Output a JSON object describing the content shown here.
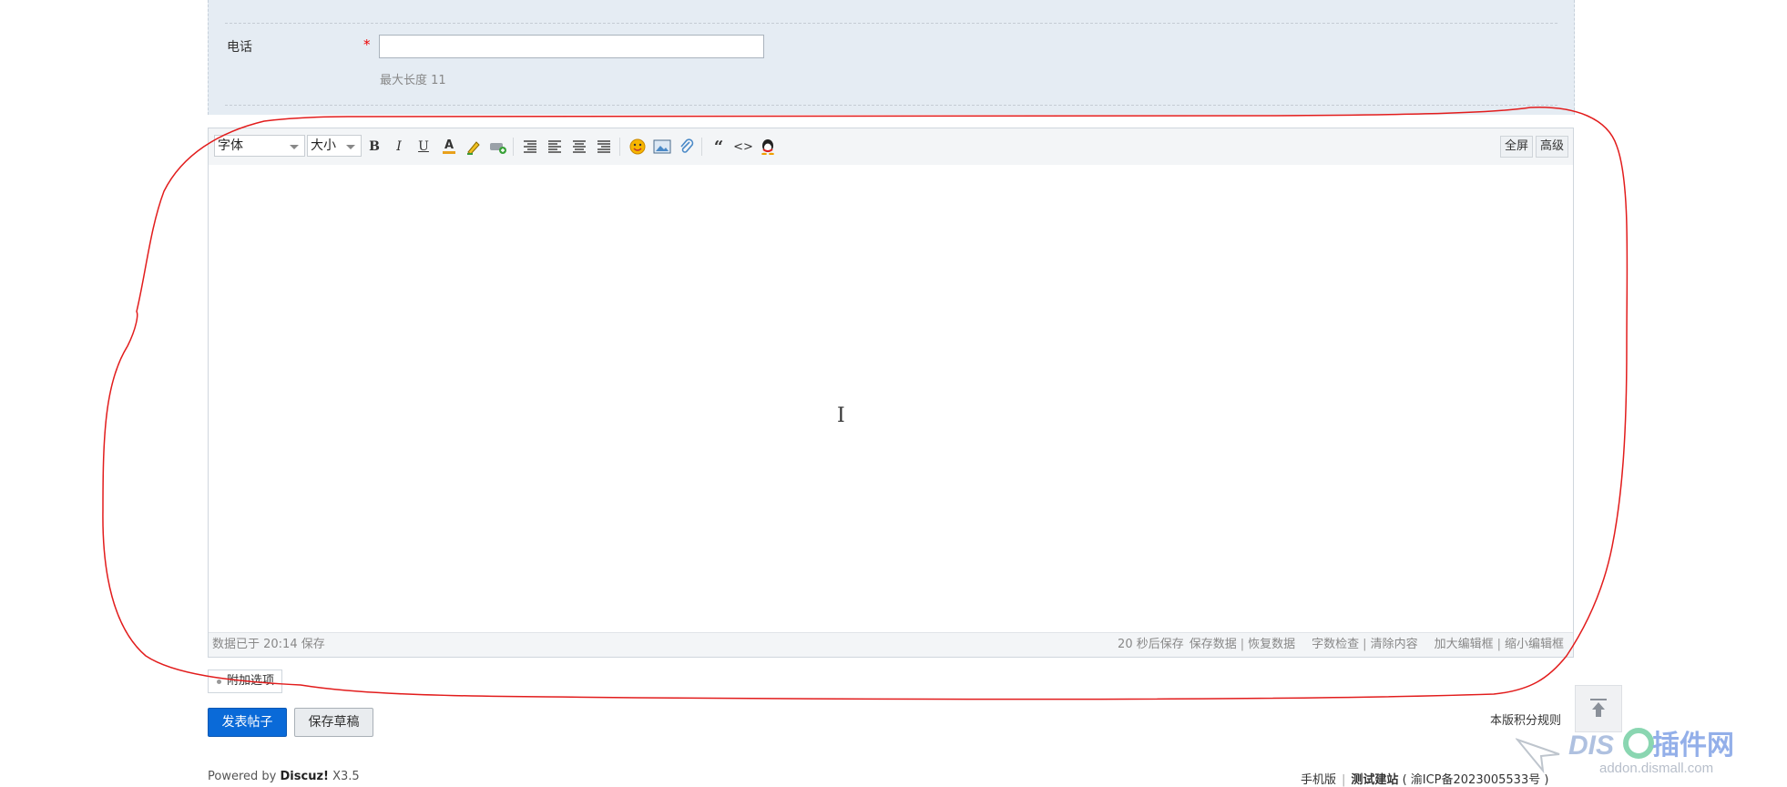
{
  "form": {
    "phone_label": "电话",
    "required_mark": "*",
    "phone_value": "",
    "phone_hint": "最大长度 11"
  },
  "editor": {
    "font_select": "字体",
    "size_select": "大小",
    "toolbar": {
      "bold": "B",
      "italic": "I",
      "underline": "U",
      "forecolor": "A",
      "quote": "“",
      "code": "<>",
      "fullscreen": "全屏",
      "advanced": "高级"
    },
    "content": "",
    "status_left": "数据已于 20:14 保存",
    "status_autosave": "20 秒后保存",
    "status_save": "保存数据",
    "status_restore": "恢复数据",
    "status_check": "字数检查",
    "status_clear": "清除内容",
    "status_enlarge": "加大编辑框",
    "status_shrink": "缩小编辑框"
  },
  "extra_options": "附加选项",
  "buttons": {
    "publish": "发表帖子",
    "save_draft": "保存草稿"
  },
  "rules_link": "本版积分规则",
  "footer": {
    "powered_prefix": "Powered by",
    "product": "Discuz!",
    "version": "X3.5",
    "mobile": "手机版",
    "site": "测试建站",
    "icp": "( 渝ICP备2023005533号 )"
  },
  "watermark": {
    "brand": "插件网",
    "url": "addon.dismall.com"
  },
  "colors": {
    "panel_bg": "#e5ecf3",
    "primary_button": "#0a6ad8",
    "annotation": "#e21c1c",
    "required": "#ee0000"
  }
}
